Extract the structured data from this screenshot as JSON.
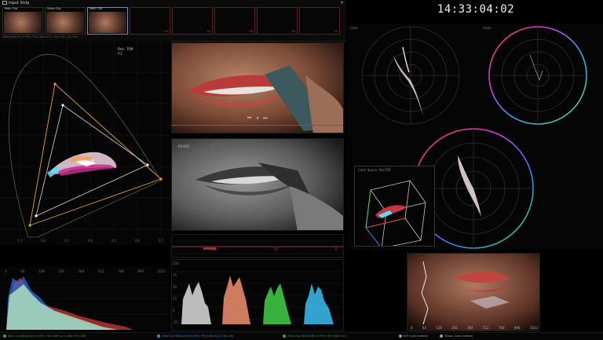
{
  "input_strip": {
    "title": "Input Strip",
    "close": "×",
    "slots": [
      {
        "label": "Main Clip",
        "filled": true,
        "selected": false
      },
      {
        "label": "Video Clip",
        "filled": true,
        "selected": false
      },
      {
        "label": "Main Clip",
        "filled": true,
        "selected": true
      },
      {
        "label": "",
        "filled": false,
        "marker": "4K"
      },
      {
        "label": "",
        "filled": false,
        "marker": "4K"
      },
      {
        "label": "",
        "filled": false,
        "marker": "4K"
      },
      {
        "label": "",
        "filled": false,
        "marker": "4K"
      },
      {
        "label": "",
        "filled": false,
        "marker": "4K"
      }
    ],
    "meta": "3840x2160 FS 23.976 | YUV 10bit 4:2:2 | Rec.709 | 1/2 Floor"
  },
  "timecode": "14:33:04:02",
  "cie": {
    "label_primary": "Rec. 709",
    "label_secondary": "P3",
    "axis_ticks": [
      "0.1",
      "0.2",
      "0.3",
      "0.4",
      "0.5",
      "0.6",
      "0.7"
    ]
  },
  "picture": {
    "player_controls": [
      "⏮",
      "⏸",
      "⏭"
    ]
  },
  "bw_picture": {
    "label": "P3 D65"
  },
  "waveform_top": {
    "top_labels": [
      "100",
      "50",
      "0"
    ],
    "scale_marks": [
      "100",
      "75",
      "50",
      "25",
      "0"
    ],
    "bottom_labels": [
      "R",
      "G",
      "B"
    ]
  },
  "histogram": {
    "ticks": [
      "0",
      "64",
      "128",
      "256",
      "384",
      "512",
      "768",
      "896",
      "1023"
    ]
  },
  "parade": {
    "ticks": [
      "-25",
      "0",
      "25",
      "50",
      "75",
      "100"
    ],
    "channels": [
      "Y",
      "R",
      "G",
      "B"
    ]
  },
  "vectorscope": {
    "left_label": "Lows",
    "right_label": "Highs"
  },
  "gamut3d": {
    "label": "Color Space: Rec709"
  },
  "overlay_wave": {
    "ticks": [
      "0",
      "64",
      "128",
      "256",
      "384",
      "512",
      "768",
      "896",
      "1023"
    ]
  },
  "footer": {
    "items": [
      {
        "text": "Main Out 3840x2160 23.976 | YUV 10bit 4:2:2 | Rec.709 | SDR",
        "color": "#3da34a"
      },
      {
        "text": "Video Out 3840x2160 23.976 | YUV 10bit 4:2:2 | Rec.709",
        "color": "#3d8fd1"
      },
      {
        "text": "Video Clip 3840x2160 23.976 | YUV 10bit 4:2:2",
        "color": "#3da34a"
      },
      {
        "text": "NTR (auto enabled)",
        "color": "#9a9a9a"
      },
      {
        "text": "Stream (auto enabled)",
        "color": "#9a9a9a"
      }
    ]
  },
  "colors": {
    "accent_red": "#c2363f",
    "gamut_orange": "#e2a23a",
    "gamut_white": "#dddddd",
    "status_green": "#3da34a"
  }
}
